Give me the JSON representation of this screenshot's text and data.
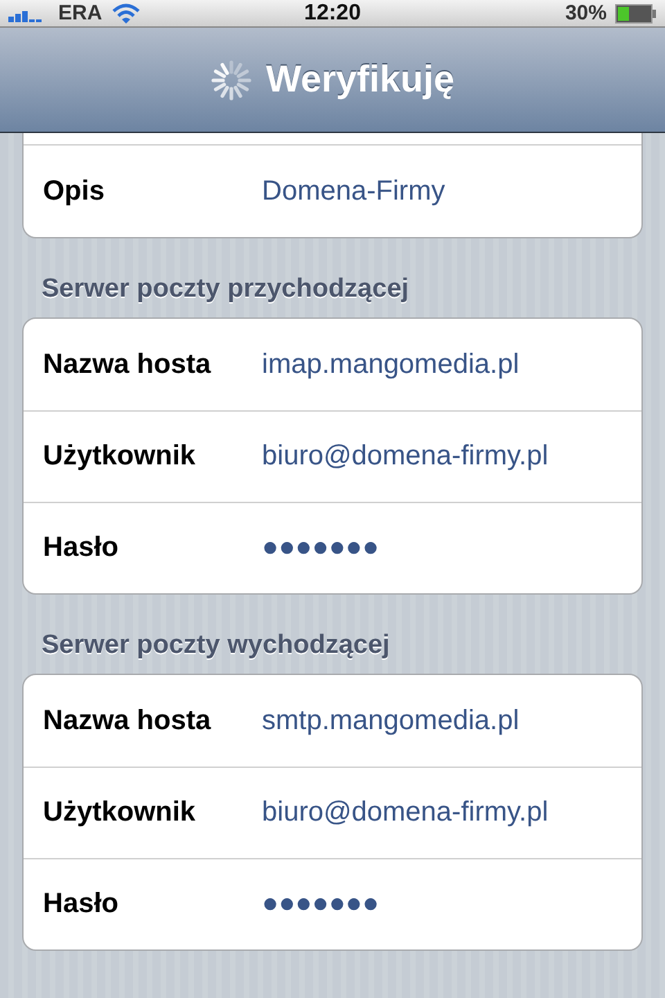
{
  "status_bar": {
    "carrier": "ERA",
    "time": "12:20",
    "battery": "30%"
  },
  "nav_bar": {
    "title": "Weryfikuję",
    "loading": true
  },
  "account": {
    "rows": [
      {
        "label": "Opis",
        "value": "Domena-Firmy"
      }
    ]
  },
  "sections": [
    {
      "header": "Serwer poczty przychodzącej",
      "rows": [
        {
          "label": "Nazwa hosta",
          "value": "imap.mangomedia.pl"
        },
        {
          "label": "Użytkownik",
          "value": "biuro@domena-firmy.pl"
        },
        {
          "label": "Hasło",
          "value": "●●●●●●●"
        }
      ]
    },
    {
      "header": "Serwer poczty wychodzącej",
      "rows": [
        {
          "label": "Nazwa hosta",
          "value": "smtp.mangomedia.pl"
        },
        {
          "label": "Użytkownik",
          "value": "biuro@domena-firmy.pl"
        },
        {
          "label": "Hasło",
          "value": "●●●●●●●"
        }
      ]
    }
  ]
}
